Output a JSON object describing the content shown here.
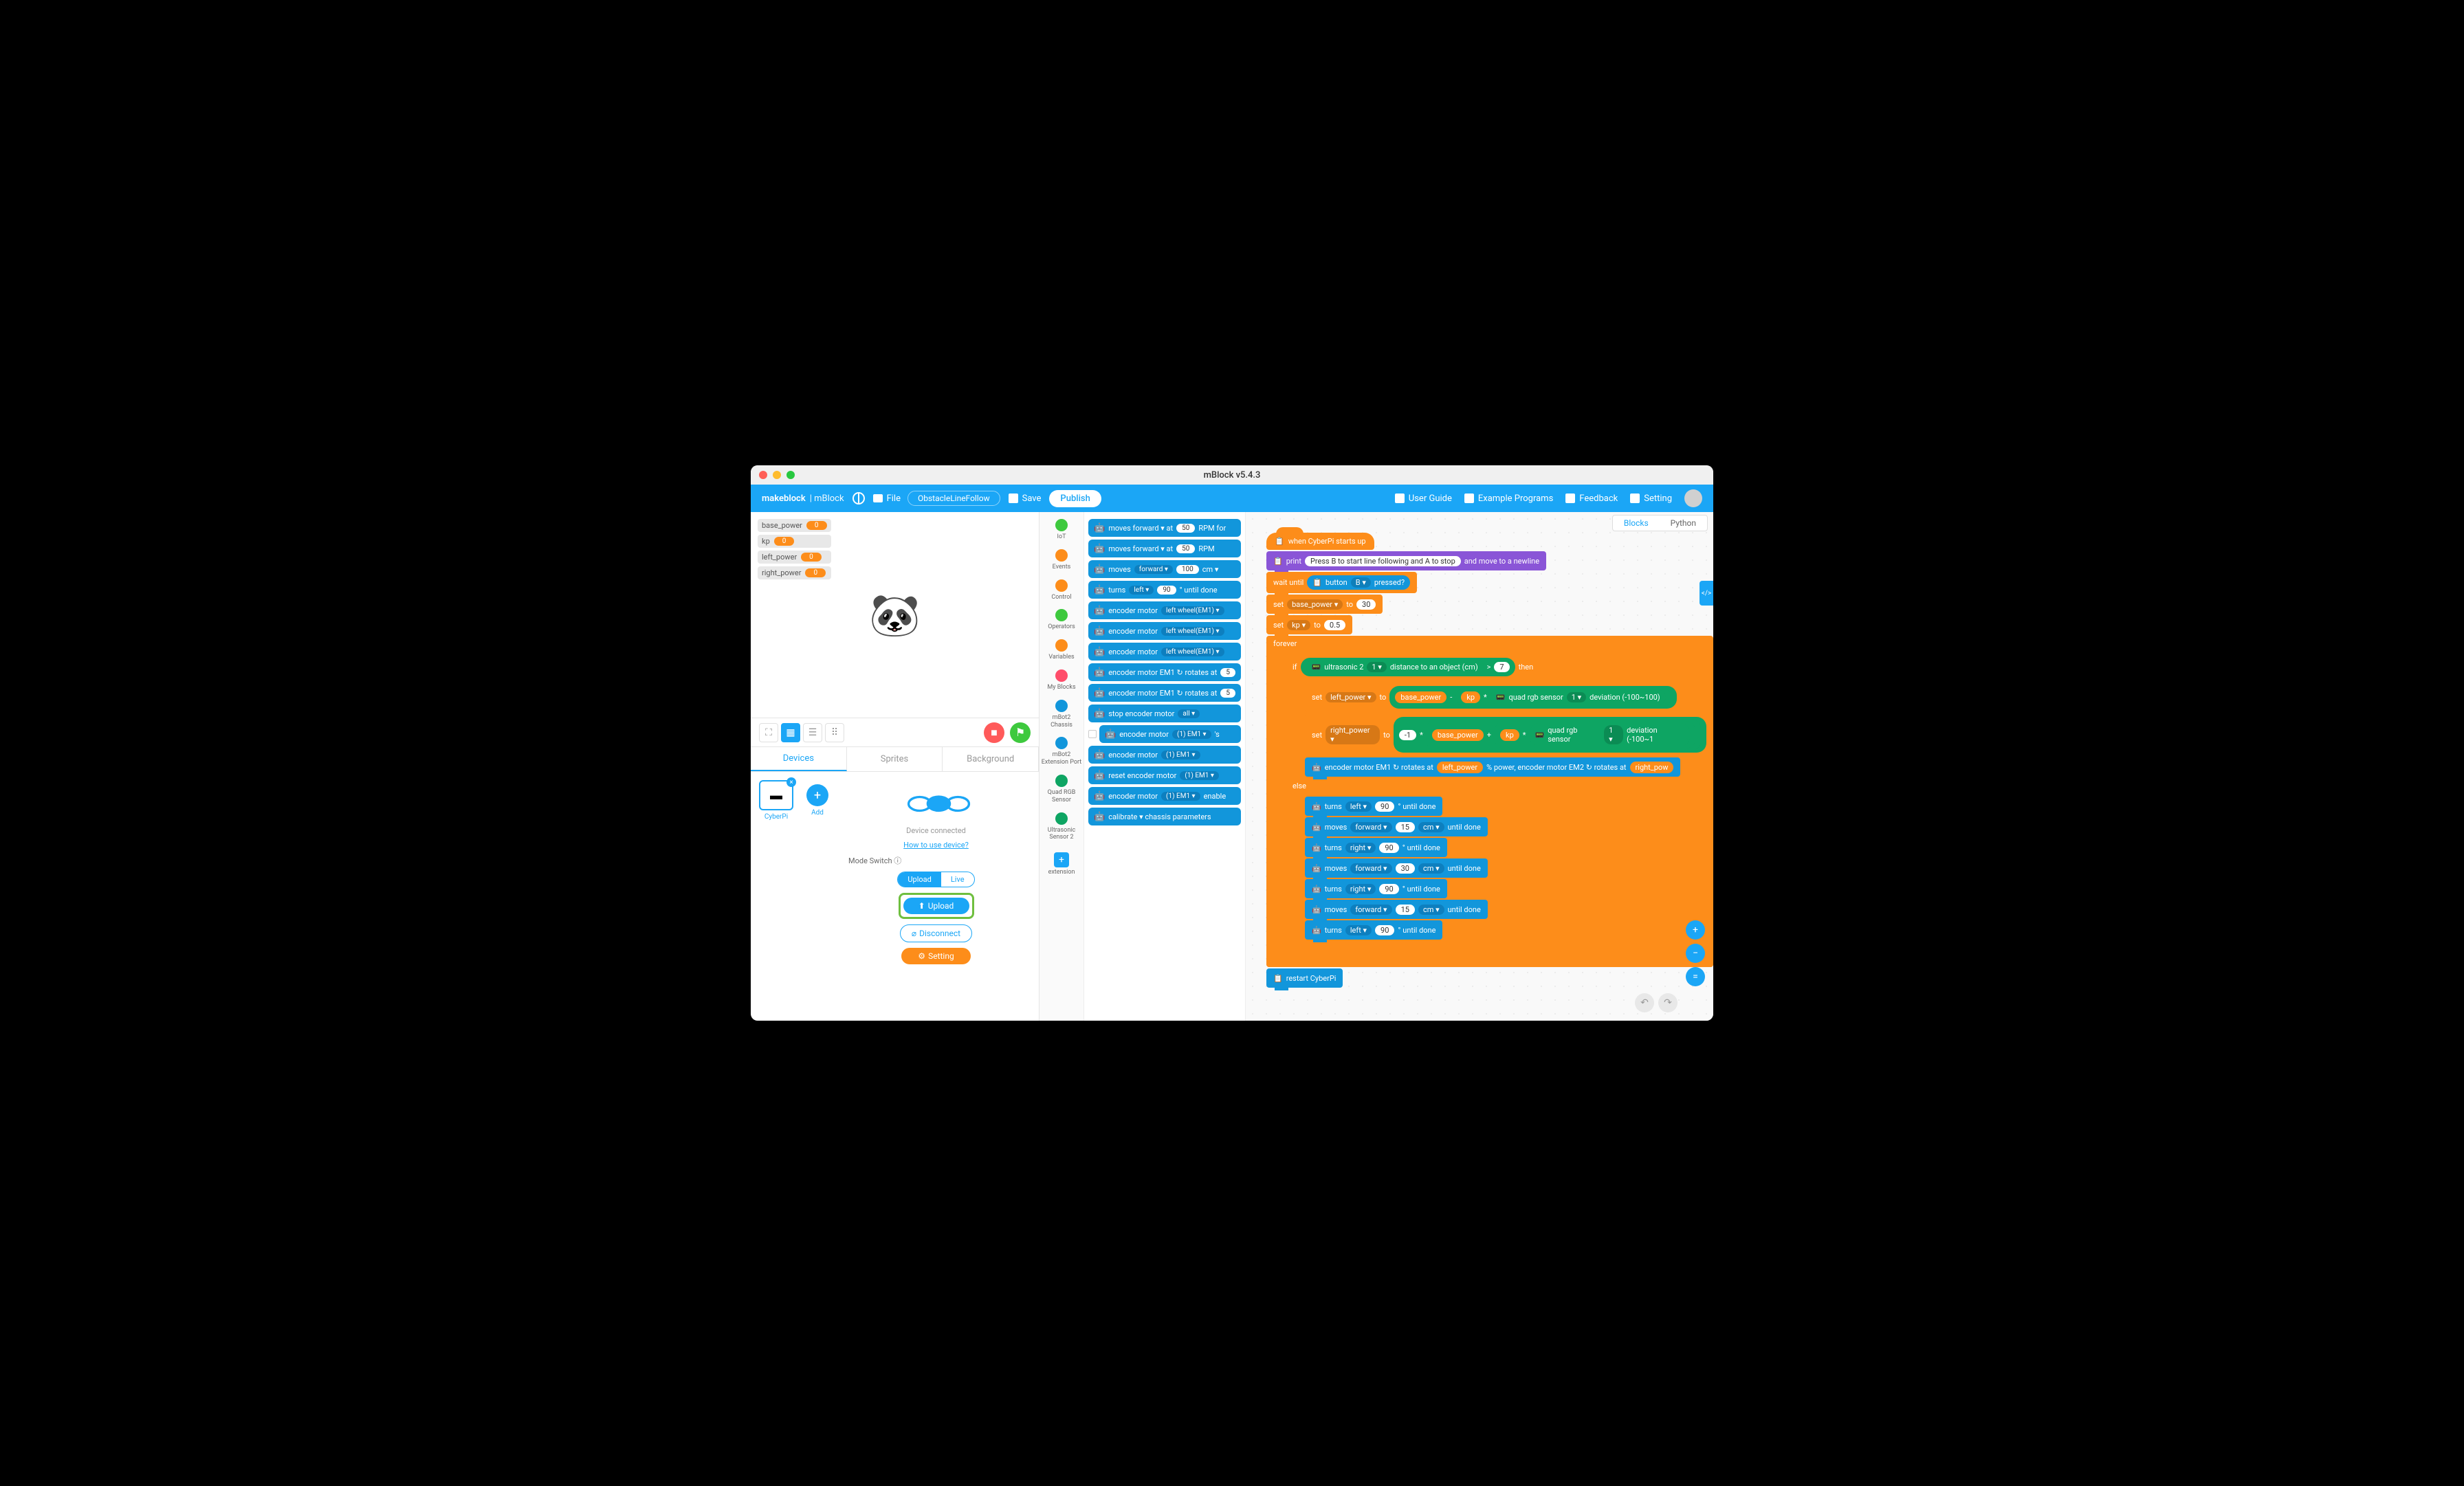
{
  "window": {
    "title": "mBlock v5.4.3"
  },
  "menu": {
    "brand": "makeblock",
    "brand2": "| mBlock",
    "file": "File",
    "project": "ObstacleLineFollow",
    "save": "Save",
    "publish": "Publish",
    "userguide": "User Guide",
    "examples": "Example Programs",
    "feedback": "Feedback",
    "setting": "Setting"
  },
  "vars": [
    {
      "name": "base_power",
      "value": "0"
    },
    {
      "name": "kp",
      "value": "0"
    },
    {
      "name": "left_power",
      "value": "0"
    },
    {
      "name": "right_power",
      "value": "0"
    }
  ],
  "tabs": {
    "devices": "Devices",
    "sprites": "Sprites",
    "background": "Background"
  },
  "device": {
    "name": "CyberPi",
    "add": "Add",
    "status": "Device connected",
    "help": "How to use device?",
    "modeswitch": "Mode Switch ⓘ",
    "upload_mode": "Upload",
    "live_mode": "Live",
    "upload_btn": "Upload",
    "disconnect": "Disconnect",
    "setting": "Setting"
  },
  "cats": [
    {
      "label": "IoT",
      "color": "#3ec93e"
    },
    {
      "label": "Events",
      "color": "#fd8d1a"
    },
    {
      "label": "Control",
      "color": "#fd8d1a"
    },
    {
      "label": "Operators",
      "color": "#3ec93e"
    },
    {
      "label": "Variables",
      "color": "#fd8d1a"
    },
    {
      "label": "My Blocks",
      "color": "#ff4d6a"
    },
    {
      "label": "mBot2 Chassis",
      "color": "#1296db"
    },
    {
      "label": "mBot2 Extension Port",
      "color": "#1296db"
    },
    {
      "label": "Quad RGB Sensor",
      "color": "#0ea563"
    },
    {
      "label": "Ultrasonic Sensor 2",
      "color": "#0ea563"
    }
  ],
  "extension": "extension",
  "palette": [
    {
      "text": "moves forward ▾ at",
      "pill": "50",
      "suffix": "RPM for"
    },
    {
      "text": "moves forward ▾ at",
      "pill": "50",
      "suffix": "RPM"
    },
    {
      "text": "moves",
      "sel": "forward ▾",
      "pill": "100",
      "suffix": "cm ▾"
    },
    {
      "text": "turns",
      "sel": "left ▾",
      "pill": "90",
      "suffix": "° until done"
    },
    {
      "text": "encoder motor",
      "sel": "left wheel(EM1) ▾"
    },
    {
      "text": "encoder motor",
      "sel": "left wheel(EM1) ▾"
    },
    {
      "text": "encoder motor",
      "sel": "left wheel(EM1) ▾"
    },
    {
      "text": "encoder motor EM1  ↻  rotates at",
      "pill": "5"
    },
    {
      "text": "encoder motor EM1  ↻  rotates at",
      "pill": "5"
    },
    {
      "text": "stop encoder motor",
      "sel": "all ▾"
    },
    {
      "chk": true,
      "text": "encoder motor",
      "sel": "(1) EM1 ▾",
      "suffix": "'s"
    },
    {
      "text": "encoder motor",
      "sel": "(1) EM1 ▾"
    },
    {
      "text": "reset encoder motor",
      "sel": "(1) EM1 ▾"
    },
    {
      "text": "encoder motor",
      "sel": "(1) EM1 ▾",
      "suffix": "enable"
    },
    {
      "text": "calibrate ▾  chassis parameters"
    }
  ],
  "script": {
    "hat": "when CyberPi starts up",
    "print": "print",
    "print_msg": "Press B to start line following and A to stop",
    "print_suffix": "and move to a newline",
    "wait": "wait until",
    "button": "button",
    "btn_b": "B ▾",
    "pressed": "pressed?",
    "set": "set",
    "to": "to",
    "base_power": "base_power ▾",
    "bp_val": "30",
    "kp": "kp ▾",
    "kp_val": "0.5",
    "forever": "forever",
    "if": "if",
    "then": "then",
    "else": "else",
    "ultra": "ultrasonic 2",
    "ultra_port": "1 ▾",
    "ultra_dist": "distance to an object (cm)",
    "gt": ">",
    "gt_val": "7",
    "left_power": "left_power ▾",
    "right_power": "right_power ▾",
    "base_power_v": "base_power",
    "kp_v": "kp",
    "minus": "-",
    "times": "*",
    "plus": "+",
    "neg1": "-1",
    "quad": "quad rgb sensor",
    "quad_port": "1 ▾",
    "deviation": "deviation (-100~100)",
    "enc": "encoder motor EM1  ↻  rotates at",
    "lp_v": "left_power",
    "enc2": "% power, encoder motor EM2  ↻  rotates at",
    "rp_v": "right_pow",
    "turns": "turns",
    "left": "left ▾",
    "right": "right ▾",
    "ninety": "90",
    "until_done": "° until done",
    "moves": "moves",
    "forward": "forward ▾",
    "fifteen": "15",
    "thirty": "30",
    "cm": "cm ▾",
    "untildone": "until done",
    "restart": "restart CyberPi"
  },
  "wstabs": {
    "blocks": "Blocks",
    "python": "Python"
  }
}
